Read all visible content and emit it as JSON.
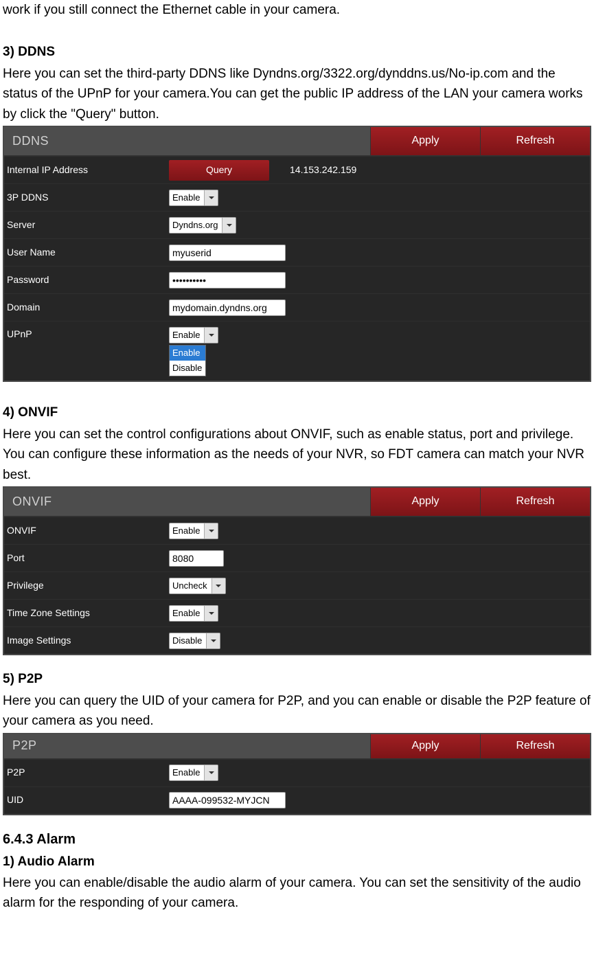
{
  "intro_text": "work if you still connect the Ethernet cable in your camera.",
  "sec_ddns": {
    "heading": "3) DDNS",
    "desc": "Here you can set the third-party DDNS like Dyndns.org/3322.org/dynddns.us/No-ip.com and the status of the UPnP for your camera.You can get the public IP address of the LAN your camera works by click the \"Query\" button.",
    "panel": {
      "title": "DDNS",
      "apply": "Apply",
      "refresh": "Refresh",
      "internal_ip_label": "Internal IP Address",
      "query_btn": "Query",
      "ip_value": "14.153.242.159",
      "p3ddns_label": "3P DDNS",
      "p3ddns_value": "Enable",
      "server_label": "Server",
      "server_value": "Dyndns.org",
      "username_label": "User Name",
      "username_value": "myuserid",
      "password_label": "Password",
      "password_value": "••••••••••",
      "domain_label": "Domain",
      "domain_value": "mydomain.dyndns.org",
      "upnp_label": "UPnP",
      "upnp_value": "Enable",
      "upnp_options": {
        "o1": "Enable",
        "o2": "Disable"
      }
    }
  },
  "sec_onvif": {
    "heading": "4) ONVIF",
    "desc": "Here you can set the control configurations about ONVIF, such as enable status, port and privilege. You can configure these information as the needs of your NVR, so FDT camera can match your NVR best.",
    "panel": {
      "title": "ONVIF",
      "apply": "Apply",
      "refresh": "Refresh",
      "onvif_label": "ONVIF",
      "onvif_value": "Enable",
      "port_label": "Port",
      "port_value": "8080",
      "privilege_label": "Privilege",
      "privilege_value": "Uncheck",
      "tz_label": "Time Zone Settings",
      "tz_value": "Enable",
      "img_label": "Image Settings",
      "img_value": "Disable"
    }
  },
  "sec_p2p": {
    "heading": "5) P2P",
    "desc": "Here you can query the UID of your camera for P2P, and you can enable or disable the P2P feature of your camera as you need.",
    "panel": {
      "title": "P2P",
      "apply": "Apply",
      "refresh": "Refresh",
      "p2p_label": "P2P",
      "p2p_value": "Enable",
      "uid_label": "UID",
      "uid_value": "AAAA-099532-MYJCN"
    }
  },
  "sec_alarm": {
    "section_heading": "6.4.3 Alarm",
    "heading": "1) Audio Alarm",
    "desc": "Here you can enable/disable the audio alarm of your camera. You can set the sensitivity of the audio alarm for the responding of your camera."
  }
}
